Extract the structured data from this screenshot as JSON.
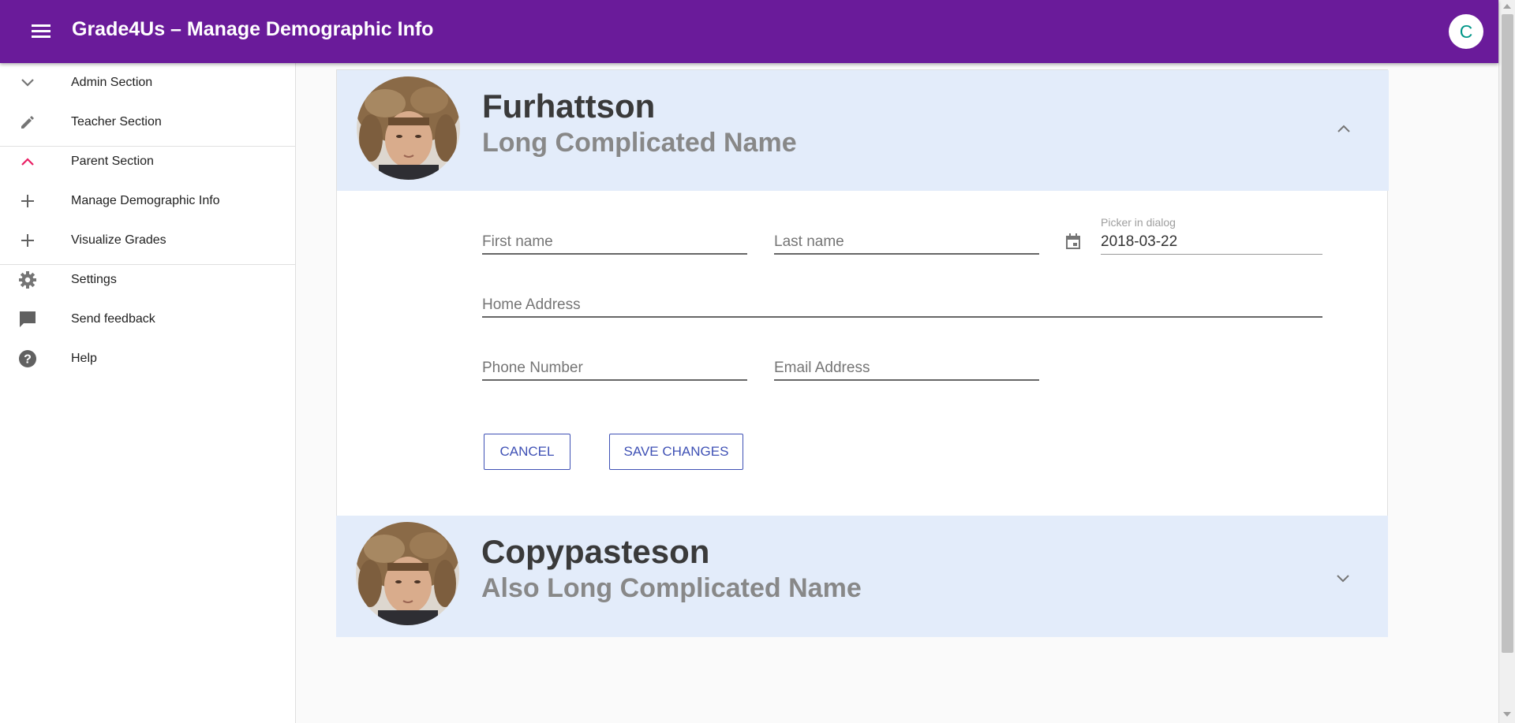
{
  "app": {
    "title": "Grade4Us – Manage Demographic Info",
    "user_initial": "C"
  },
  "sidebar": {
    "items": [
      {
        "label": "Admin Section",
        "icon": "chevron-down-icon"
      },
      {
        "label": "Teacher Section",
        "icon": "pencil-icon"
      },
      {
        "label": "Parent Section",
        "icon": "chevron-up-icon"
      },
      {
        "label": "Manage Demographic Info",
        "icon": "plus-icon"
      },
      {
        "label": "Visualize Grades",
        "icon": "plus-icon"
      },
      {
        "label": "Settings",
        "icon": "gear-icon"
      },
      {
        "label": "Send feedback",
        "icon": "feedback-icon"
      },
      {
        "label": "Help",
        "icon": "help-icon"
      }
    ]
  },
  "students": [
    {
      "name": "Furhattson",
      "full_name": "Long Complicated Name",
      "expanded": true,
      "form": {
        "first_name_label": "First name",
        "last_name_label": "Last name",
        "date_label": "Picker in dialog",
        "date_value": "2018-03-22",
        "home_address_label": "Home Address",
        "phone_label": "Phone Number",
        "email_label": "Email Address",
        "cancel_label": "CANCEL",
        "save_label": "SAVE CHANGES"
      }
    },
    {
      "name": "Copypasteson",
      "full_name": "Also Long Complicated Name",
      "expanded": false
    }
  ],
  "colors": {
    "appbar": "#6a1b9a",
    "accent": "#e91e63",
    "button": "#3f51b5",
    "card_header": "#e3ecfa",
    "avatar_text": "#009688"
  }
}
